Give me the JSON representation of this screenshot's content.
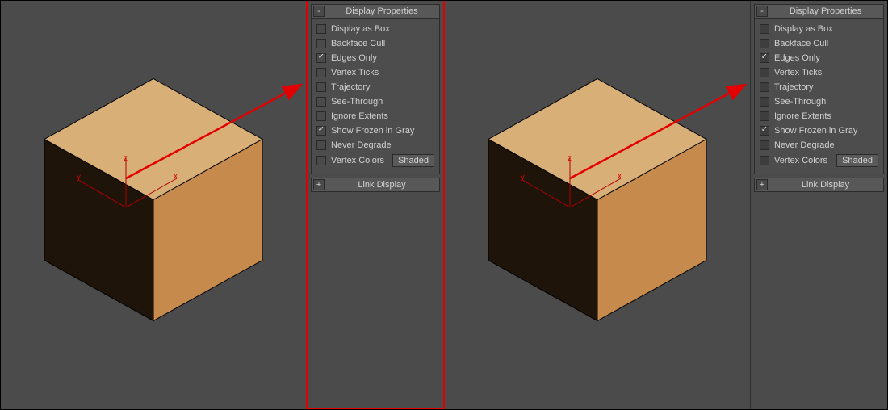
{
  "left": {
    "header": {
      "collapse_glyph": "-",
      "title": "Display Properties"
    },
    "options": [
      {
        "label": "Display as Box",
        "checked": false
      },
      {
        "label": "Backface Cull",
        "checked": false
      },
      {
        "label": "Edges Only",
        "checked": true
      },
      {
        "label": "Vertex Ticks",
        "checked": false
      },
      {
        "label": "Trajectory",
        "checked": false
      },
      {
        "label": "See-Through",
        "checked": false
      },
      {
        "label": "Ignore Extents",
        "checked": false
      },
      {
        "label": "Show Frozen in Gray",
        "checked": true
      },
      {
        "label": "Never Degrade",
        "checked": false
      },
      {
        "label": "Vertex Colors",
        "checked": false
      }
    ],
    "shaded_btn": "Shaded",
    "link_header": {
      "collapse_glyph": "+",
      "title": "Link Display"
    },
    "axes": {
      "x": "x",
      "y": "y",
      "z": "z"
    }
  },
  "right": {
    "header": {
      "collapse_glyph": "-",
      "title": "Display Properties"
    },
    "options": [
      {
        "label": "Display as Box",
        "checked": false
      },
      {
        "label": "Backface Cull",
        "checked": false
      },
      {
        "label": "Edges Only",
        "checked": true
      },
      {
        "label": "Vertex Ticks",
        "checked": false
      },
      {
        "label": "Trajectory",
        "checked": false
      },
      {
        "label": "See-Through",
        "checked": false
      },
      {
        "label": "Ignore Extents",
        "checked": false
      },
      {
        "label": "Show Frozen in Gray",
        "checked": true
      },
      {
        "label": "Never Degrade",
        "checked": false
      },
      {
        "label": "Vertex Colors",
        "checked": false
      }
    ],
    "shaded_btn": "Shaded",
    "link_header": {
      "collapse_glyph": "+",
      "title": "Link Display"
    },
    "axes": {
      "x": "x",
      "y": "y",
      "z": "z"
    }
  }
}
